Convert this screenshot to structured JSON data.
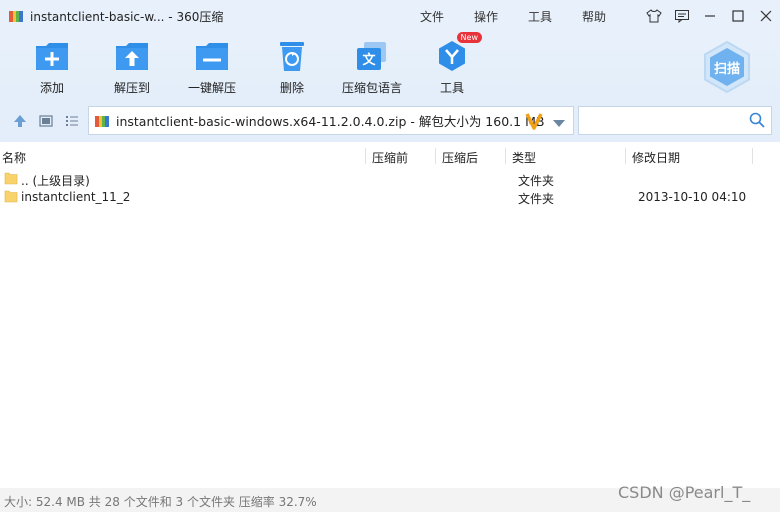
{
  "window": {
    "title": "instantclient-basic-w... - 360压缩"
  },
  "menus": [
    "文件",
    "操作",
    "工具",
    "帮助"
  ],
  "toolbar": {
    "add_label": "添加",
    "extract_to_label": "解压到",
    "one_click_label": "一键解压",
    "delete_label": "删除",
    "language_label": "压缩包语言",
    "tools_label": "工具",
    "tools_badge": "New",
    "scan_label": "扫描"
  },
  "path": {
    "value": "instantclient-basic-windows.x64-11.2.0.4.0.zip - 解包大小为 160.1 MB"
  },
  "columns": {
    "name": "名称",
    "compressed": "压缩前",
    "uncompressed": "压缩后",
    "type": "类型",
    "modified": "修改日期"
  },
  "files": [
    {
      "name": ".. (上级目录)",
      "type": "文件夹",
      "modified": ""
    },
    {
      "name": "instantclient_11_2",
      "type": "文件夹",
      "modified": "2013-10-10 04:10"
    }
  ],
  "status": {
    "text": "大小: 52.4 MB 共 28 个文件和 3 个文件夹 压缩率 32.7%"
  },
  "watermark": "CSDN @Pearl_T_",
  "colors": {
    "accent_blue": "#2f8ee8",
    "toolbar_bg": "#e3eefa",
    "folder_yellow": "#f8d26a"
  }
}
